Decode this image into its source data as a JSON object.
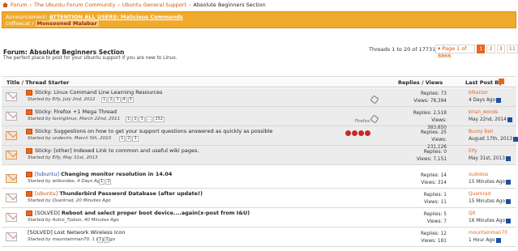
{
  "breadcrumb": {
    "items": [
      "Forum",
      "The Ubuntu Forum Community",
      "Ubuntu General Support"
    ],
    "current": "Absolute Beginners Section"
  },
  "announcement": {
    "label": "Announcement:",
    "link": "ATTENTION ALL USERS: Malicious Commands",
    "user": "coffeecat",
    "sender": "Monsooned Malabar"
  },
  "forum": {
    "title": "Forum: Absolute Beginners Section",
    "description": "The perfect place to post for your Ubuntu support if you are new to Linux.",
    "threads_info": "Threads 1 to 20 of 177314",
    "pager": {
      "page_of": "▾ Page 1 of 8866",
      "pages": [
        "1",
        "2",
        "3",
        "11"
      ]
    }
  },
  "columns": {
    "title": "Title / Thread Starter",
    "stats": "Replies / Views",
    "last_post": "Last Post By"
  },
  "sticky_threads": [
    {
      "prefix": "Sticky:",
      "title": "Linux Command Line Learning Resources",
      "meta": "Started by Elfy, July 2nd, 2012",
      "pages": [
        "1",
        "2",
        "3",
        "4",
        "5"
      ],
      "replies": "Replies: 73",
      "views": "Views: 78,394",
      "last_user": "bfkarzor",
      "last_time": "4 Days Ago"
    },
    {
      "prefix": "Sticky:",
      "title": "Firefox +1 Mega Thread",
      "meta": "Started by lovinglinux, March 22nd, 2011",
      "pages": [
        "1",
        "2",
        "3",
        "...",
        "252"
      ],
      "replies": "Replies: 2,518",
      "views": "Views: 383,650",
      "last_user": "brian_woods",
      "last_time": "May 22nd, 2014",
      "extra": "Firefox"
    },
    {
      "prefix": "Sticky:",
      "title": "Suggestions on how to get your support questions answered as quickly as possible",
      "meta": "Started by undecim, March 5th, 2010",
      "pages": [
        "1",
        "2",
        "3"
      ],
      "replies": "Replies: 25",
      "views": "Views: 231,126",
      "last_user": "Bucky Ball",
      "last_time": "August 17th, 2013"
    },
    {
      "prefix": "Sticky:",
      "title": "[other] Indexed Link to common and useful wiki pages.",
      "meta": "Started by Elfy, May 31st, 2013",
      "pages": [],
      "replies": "Replies: 0",
      "views": "Views: 7,151",
      "last_user": "Elfy",
      "last_time": "May 31st, 2013"
    }
  ],
  "threads": [
    {
      "prefix": "[lubuntu]",
      "title": "Changing monitor resolution in 14.04",
      "meta": "Started by wilburdee, 4 Days Ago",
      "pages": [
        "1",
        "2"
      ],
      "replies": "Replies: 14",
      "views": "Views: 314",
      "last_user": "sudodus",
      "last_time": "15 Minutes Ago"
    },
    {
      "prefix": "[ubuntu]",
      "title": "Thunderbird Password Database (after update!)",
      "meta": "Started by Quarkrad, 20 Minutes Ago",
      "pages": [],
      "replies": "Replies: 1",
      "views": "Views: 11",
      "last_user": "Quarkrad",
      "last_time": "15 Minutes Ago"
    },
    {
      "prefix": "[SOLVED]",
      "title": "Reboot and select proper boot device....again(x-post from I&U)",
      "meta": "Started by Autro_Tjsbon, 40 Minutes Ago",
      "pages": [],
      "replies": "Replies: 5",
      "views": "Views: 7",
      "last_user": "Qlt",
      "last_time": "16 Minutes Ago"
    },
    {
      "prefix": "[SOLVED]",
      "title": "Lost Network Wireless Icon",
      "meta": "Started by mountainman70, 1 Day Ago",
      "pages": [
        "1",
        "2"
      ],
      "replies": "Replies: 12",
      "views": "Views: 181",
      "last_user": "mountainman70",
      "last_time": "1 Hour Ago"
    }
  ]
}
